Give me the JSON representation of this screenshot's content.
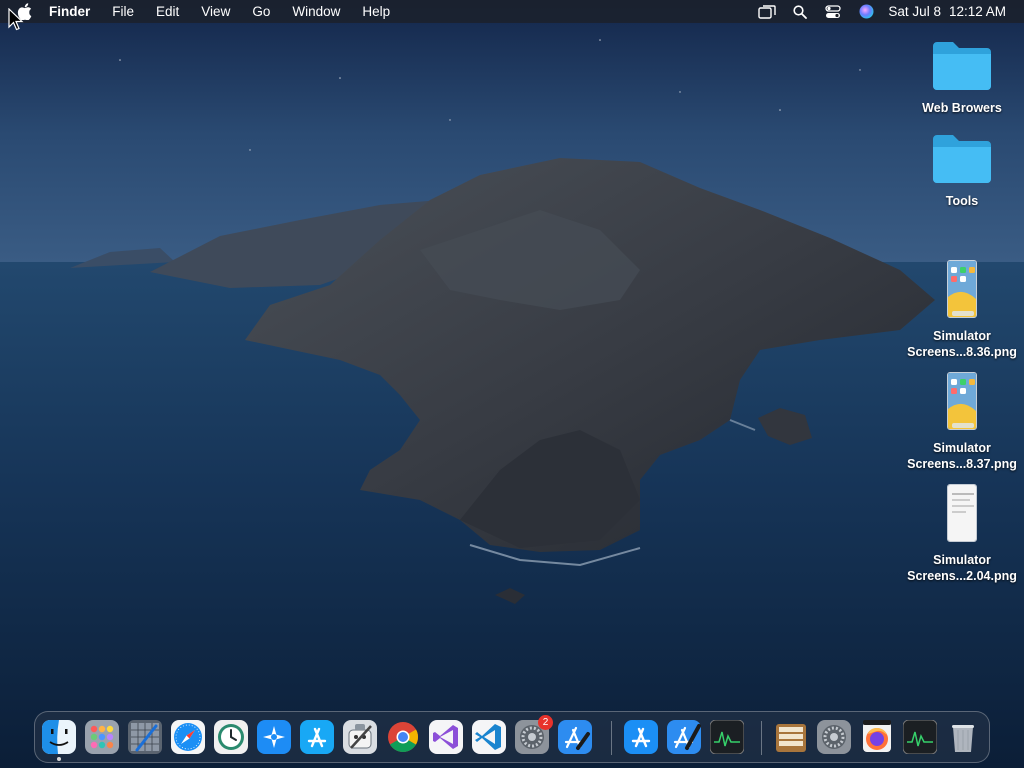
{
  "menubar": {
    "app_name": "Finder",
    "items": [
      "File",
      "Edit",
      "View",
      "Go",
      "Window",
      "Help"
    ],
    "status_icons": [
      "screen-mirroring-icon",
      "spotlight-search-icon",
      "control-center-icon",
      "siri-icon"
    ],
    "date": "Sat Jul 8",
    "time": "12:12 AM"
  },
  "desktop": {
    "items": [
      {
        "type": "folder",
        "label": "Web Browers"
      },
      {
        "type": "folder",
        "label": "Tools"
      },
      {
        "type": "png",
        "label_line1": "Simulator",
        "label_line2": "Screens...8.36.png"
      },
      {
        "type": "png",
        "label_line1": "Simulator",
        "label_line2": "Screens...8.37.png"
      },
      {
        "type": "png",
        "label_line1": "Simulator",
        "label_line2": "Screens...2.04.png"
      }
    ]
  },
  "dock": {
    "apps": [
      {
        "name": "finder-icon",
        "running": true
      },
      {
        "name": "launchpad-icon"
      },
      {
        "name": "xcode-instruments-icon"
      },
      {
        "name": "safari-icon"
      },
      {
        "name": "time-machine-icon"
      },
      {
        "name": "testflight-icon"
      },
      {
        "name": "app-store-connect-icon"
      },
      {
        "name": "automator-icon"
      },
      {
        "name": "chrome-icon"
      },
      {
        "name": "visual-studio-icon"
      },
      {
        "name": "vs-code-icon"
      },
      {
        "name": "system-preferences-icon",
        "badge": "2"
      },
      {
        "name": "xcode-icon"
      },
      {
        "name": "app-store-icon"
      },
      {
        "name": "xcode-icon-2"
      },
      {
        "name": "activity-monitor-icon"
      },
      {
        "name": "archive-utility-icon"
      },
      {
        "name": "system-preferences-icon-2"
      },
      {
        "name": "firefox-icon"
      },
      {
        "name": "activity-monitor-icon-2"
      },
      {
        "name": "trash-icon"
      }
    ]
  },
  "colors": {
    "menubar": "#1c2028",
    "folder": "#3cb4f0",
    "badge": "#e8322b"
  }
}
